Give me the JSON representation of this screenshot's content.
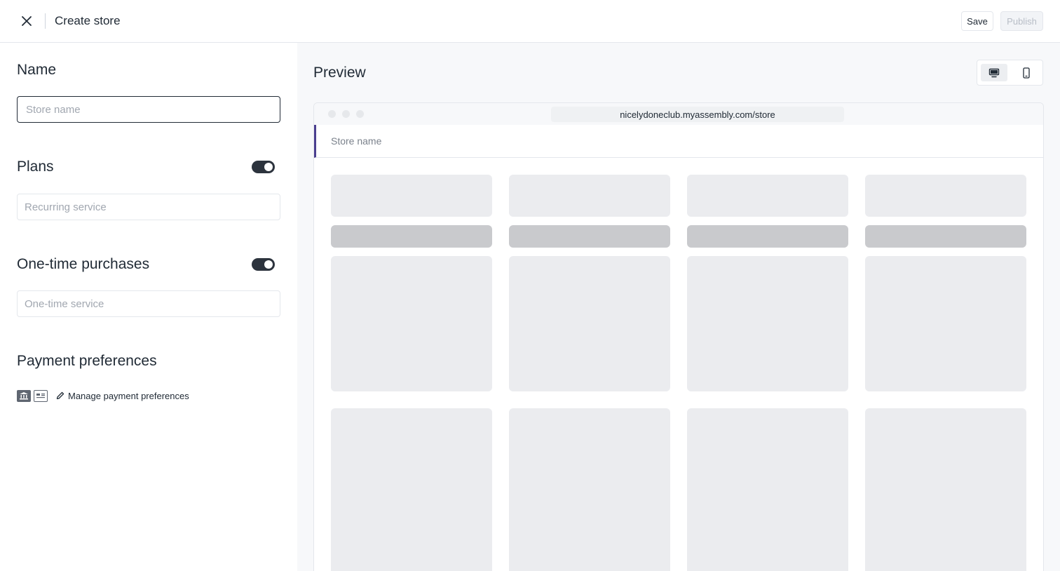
{
  "header": {
    "close_icon": "close-icon",
    "title": "Create store",
    "save_label": "Save",
    "publish_label": "Publish"
  },
  "form": {
    "name": {
      "title": "Name",
      "placeholder": "Store name"
    },
    "plans": {
      "title": "Plans",
      "enabled": true,
      "placeholder": "Recurring service"
    },
    "one_time": {
      "title": "One-time purchases",
      "enabled": true,
      "placeholder": "One-time service"
    },
    "payment": {
      "title": "Payment preferences",
      "icons": [
        "bank-icon",
        "card-icon"
      ],
      "manage_label": "Manage payment preferences"
    }
  },
  "preview": {
    "title": "Preview",
    "devices": [
      "desktop-icon",
      "mobile-icon"
    ],
    "selected_device": "desktop",
    "url": "nicelydoneclub.myassembly.com/store",
    "store_name": "Store name"
  },
  "colors": {
    "accent_bar": "#4b3f8f",
    "toggle_on": "#2c333d",
    "text": "#212b36",
    "skeleton": "#ebecef",
    "skeleton_dark": "#c9cacd"
  }
}
